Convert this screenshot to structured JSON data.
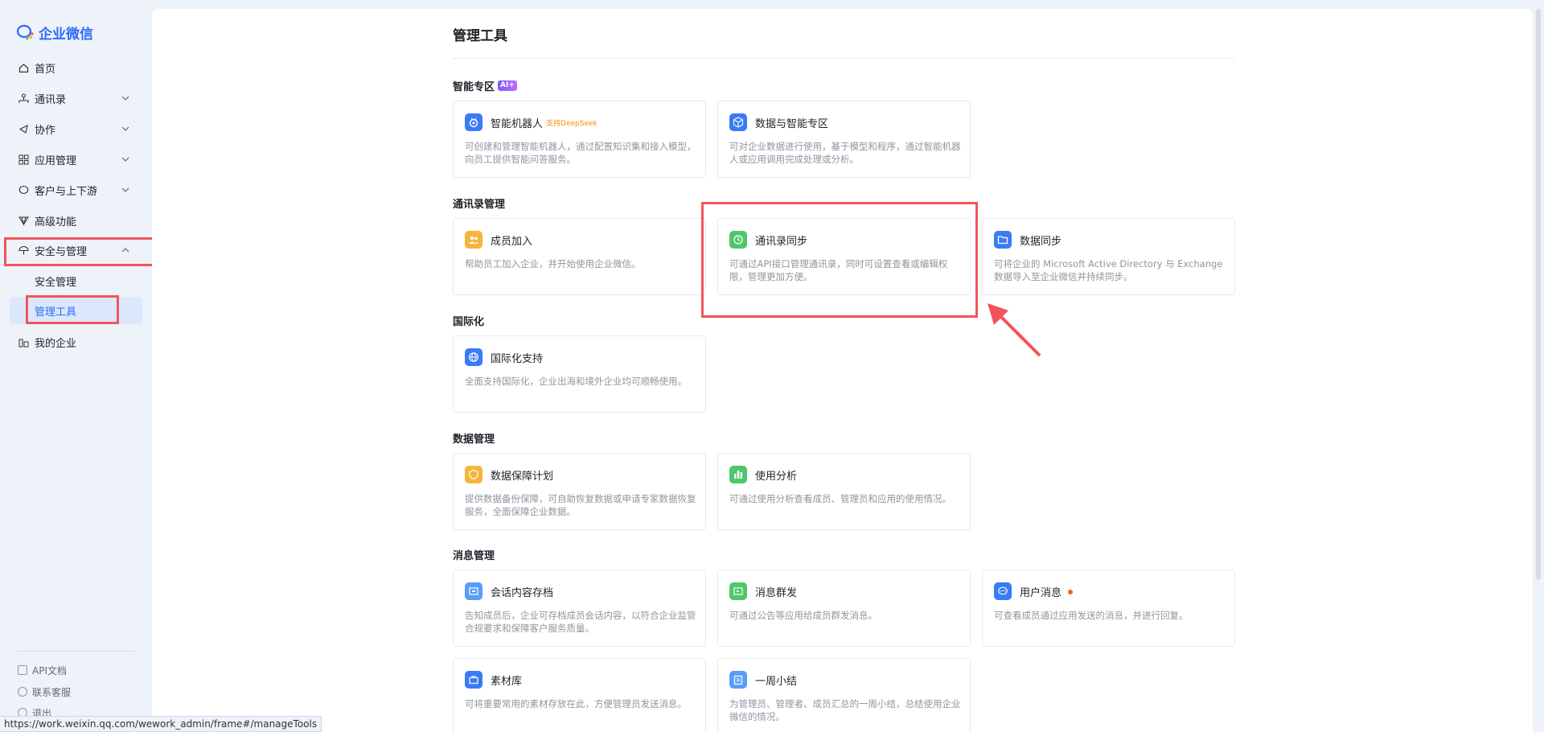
{
  "app": {
    "logo_text": "企业微信"
  },
  "sidebar": {
    "items": [
      {
        "label": "首页",
        "icon": "home-icon"
      },
      {
        "label": "通讯录",
        "icon": "org-icon"
      },
      {
        "label": "协作",
        "icon": "collab-icon"
      },
      {
        "label": "应用管理",
        "icon": "apps-icon"
      },
      {
        "label": "客户与上下游",
        "icon": "chat-icon"
      },
      {
        "label": "高级功能",
        "icon": "advanced-icon"
      },
      {
        "label": "安全与管理",
        "icon": "umbrella-icon"
      },
      {
        "label": "我的企业",
        "icon": "company-icon"
      }
    ],
    "sub_items": [
      {
        "label": "安全管理"
      },
      {
        "label": "管理工具"
      }
    ],
    "footer": [
      {
        "label": "API文档"
      },
      {
        "label": "联系客服"
      },
      {
        "label": "退出"
      }
    ]
  },
  "main": {
    "title": "管理工具",
    "ai_badge": "AI+",
    "sections": [
      {
        "title": "智能专区"
      },
      {
        "title": "通讯录管理"
      },
      {
        "title": "国际化"
      },
      {
        "title": "数据管理"
      },
      {
        "title": "消息管理"
      }
    ],
    "cards": {
      "robot": {
        "name": "智能机器人",
        "tag": "支持DeepSeek",
        "desc": "可创建和管理智能机器人，通过配置知识集和接入模型，向员工提供智能问答服务。",
        "color": "#3a7bf6"
      },
      "data_ai": {
        "name": "数据与智能专区",
        "desc": "可对企业数据进行使用，基于模型和程序，通过智能机器人或应用调用完成处理或分析。",
        "color": "#3a7bf6"
      },
      "member_join": {
        "name": "成员加入",
        "desc": "帮助员工加入企业，并开始使用企业微信。",
        "color": "#f5b53d"
      },
      "contact_sync": {
        "name": "通讯录同步",
        "desc": "可通过API接口管理通讯录，同时可设置查看或编辑权限，管理更加方便。",
        "color": "#4ec76a"
      },
      "data_sync": {
        "name": "数据同步",
        "desc": "可将企业的 Microsoft Active Directory 与 Exchange 数据导入至企业微信并持续同步。",
        "color": "#3a7bf6"
      },
      "intl": {
        "name": "国际化支持",
        "desc": "全面支持国际化，企业出海和境外企业均可顺畅使用。",
        "color": "#3a7bf6"
      },
      "data_protect": {
        "name": "数据保障计划",
        "desc": "提供数据备份保障，可自助恢复数据或申请专家数据恢复服务，全面保障企业数据。",
        "color": "#f5b53d"
      },
      "usage": {
        "name": "使用分析",
        "desc": "可通过使用分析查看成员、管理员和应用的使用情况。",
        "color": "#4ec76a"
      },
      "archive": {
        "name": "会话内容存档",
        "desc": "告知成员后，企业可存档成员会话内容，以符合企业监管合规要求和保障客户服务质量。",
        "color": "#5a9df8"
      },
      "broadcast": {
        "name": "消息群发",
        "desc": "可通过公告等应用给成员群发消息。",
        "color": "#4ec76a"
      },
      "user_msg": {
        "name": "用户消息",
        "desc": "可查看成员通过应用发送的消息，并进行回复。",
        "color": "#3a7bf6"
      },
      "materials": {
        "name": "素材库",
        "desc": "可将重要常用的素材存放在此，方便管理员发送消息。",
        "color": "#3a7bf6"
      },
      "weekly": {
        "name": "一周小结",
        "desc": "为管理员、管理者、成员汇总的一周小结，总结使用企业微信的情况。",
        "color": "#5a9df8"
      }
    }
  },
  "status_bar": {
    "url": "https://work.weixin.qq.com/wework_admin/frame#/manageTools"
  },
  "colors": {
    "accent": "#2b6cf6",
    "highlight": "#f2545b",
    "active_bg": "#dce7fb"
  }
}
